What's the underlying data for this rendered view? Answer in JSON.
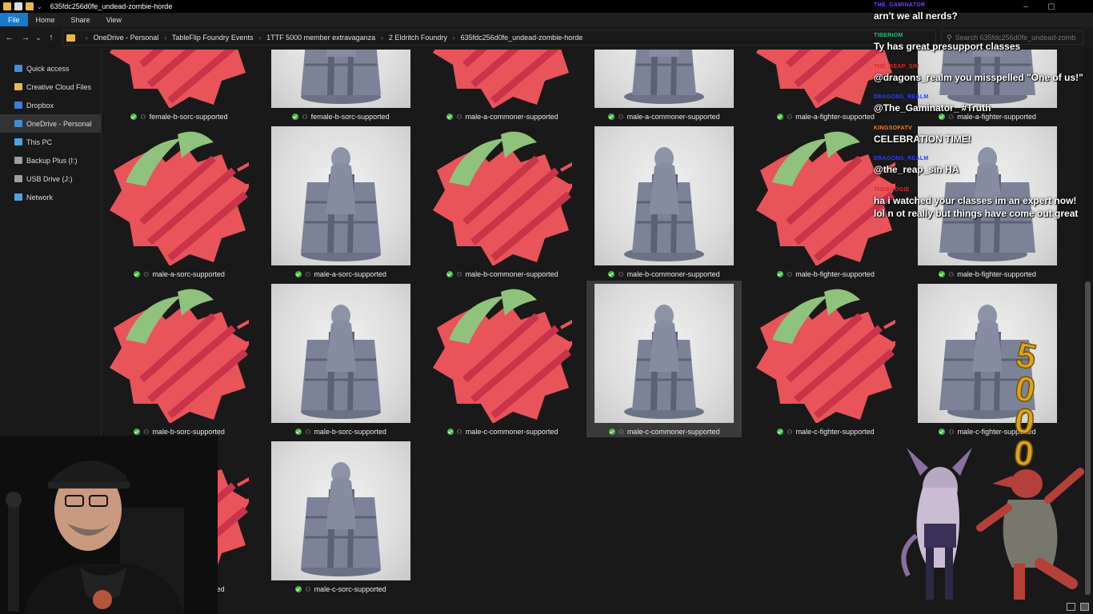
{
  "window": {
    "title": "635fdc256d0fe_undead-zombie-horde",
    "minimize_glyph": "–",
    "maximize_glyph": "▢",
    "close_glyph": "✕"
  },
  "ribbon": {
    "tabs": [
      "File",
      "Home",
      "Share",
      "View"
    ]
  },
  "nav": {
    "back_glyph": "←",
    "forward_glyph": "→",
    "dropdown_glyph": "⌄",
    "up_glyph": "↑"
  },
  "address": {
    "crumbs": [
      "OneDrive - Personal",
      "TableFlip Foundry Events",
      "1TTF 5000 member extravaganza",
      "2 Eldritch Foundry",
      "635fdc256d0fe_undead-zombie-horde"
    ],
    "separator": "›"
  },
  "search": {
    "placeholder": "Search 635fdc256d0fe_undead-zombi..."
  },
  "sidebar": {
    "items": [
      {
        "label": "Quick access",
        "icon": "star-icon",
        "color": "#3d8fe0"
      },
      {
        "label": "Creative Cloud Files",
        "icon": "folder-icon",
        "color": "#e9b949"
      },
      {
        "label": "Dropbox",
        "icon": "dropbox-icon",
        "color": "#3d7de0"
      },
      {
        "label": "OneDrive - Personal",
        "icon": "cloud-icon",
        "color": "#3a8fd8"
      },
      {
        "label": "This PC",
        "icon": "pc-icon",
        "color": "#4aa3e6"
      },
      {
        "label": "Backup Plus (I:)",
        "icon": "drive-icon",
        "color": "#9aa0a6"
      },
      {
        "label": "USB Drive (J:)",
        "icon": "drive-icon",
        "color": "#9aa0a6"
      },
      {
        "label": "Network",
        "icon": "network-icon",
        "color": "#4aa3e6"
      }
    ],
    "selected_index": 3
  },
  "files": {
    "rows": [
      [
        "female-b-sorc-supported",
        "female-b-sorc-supported",
        "male-a-commoner-supported",
        "male-a-commoner-supported",
        "male-a-fighter-supported",
        "male-a-fighter-supported"
      ],
      [
        "male-a-sorc-supported",
        "male-a-sorc-supported",
        "male-b-commoner-supported",
        "male-b-commoner-supported",
        "male-b-fighter-supported",
        "male-b-fighter-supported"
      ],
      [
        "male-b-sorc-supported",
        "male-b-sorc-supported",
        "male-c-commoner-supported",
        "male-c-commoner-supported",
        "male-c-fighter-supported",
        "male-c-fighter-supported"
      ],
      [
        "male-c-sorc-supported",
        "male-c-sorc-supported"
      ]
    ],
    "selected": "male-c-commoner-supported"
  },
  "chat": {
    "messages": [
      {
        "user": "THE_GAMINATOR",
        "user_color": "#7b3cff",
        "text": "arn't we all nerds?"
      },
      {
        "user": "TIBERIOM",
        "user_color": "#1ec07a",
        "text": "Ty has great presupport classes"
      },
      {
        "user": "THE_REAP_SIN",
        "user_color": "#d62b2b",
        "text": "@dragons_realm you misspelled \"One of us!\""
      },
      {
        "user": "DRAGONS_REALM",
        "user_color": "#2b3cff",
        "text": "@The_Gaminator_ #Truth"
      },
      {
        "user": "KINGSOFATV",
        "user_color": "#ff7a1a",
        "text": "CELEBRATION TIME!"
      },
      {
        "user": "DRAGONS_REALM",
        "user_color": "#2b3cff",
        "text": "@the_reap_sin HA"
      },
      {
        "user": "THEBOOGIE",
        "user_color": "#d62b2b",
        "text": "ha i watched your classes im an expert now! lol n ot really but things have come out great"
      }
    ]
  },
  "overlay": {
    "milestone": "5000"
  },
  "colors": {
    "accent": "#1979ca",
    "sync_ok": "#3fb83f",
    "background": "#191919"
  }
}
